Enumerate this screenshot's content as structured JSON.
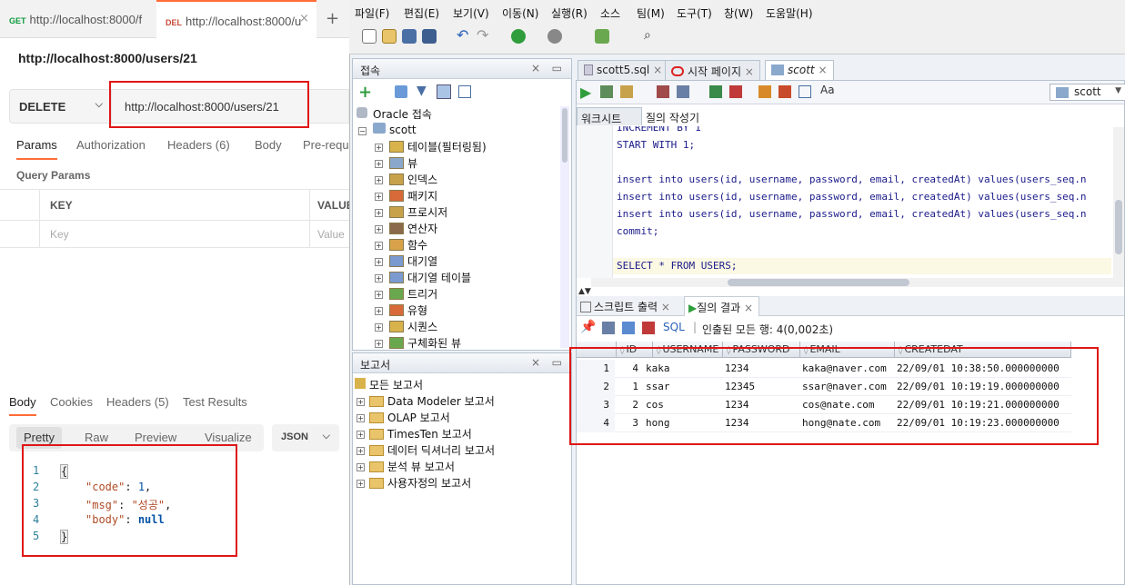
{
  "postman": {
    "tabs": [
      {
        "method": "GET",
        "label": "http://localhost:8000/f"
      },
      {
        "method": "DEL",
        "label": "http://localhost:8000/u"
      }
    ],
    "title": "http://localhost:8000/users/21",
    "method": "DELETE",
    "url": "http://localhost:8000/users/21",
    "request_tabs": {
      "params": "Params",
      "authorization": "Authorization",
      "headers": "Headers",
      "headers_count": "(6)",
      "body": "Body",
      "prerequest": "Pre-requ"
    },
    "query_params": "Query Params",
    "kv": {
      "key_header": "KEY",
      "value_header": "VALUE",
      "key_placeholder": "Key",
      "value_placeholder": "Value"
    },
    "response_tabs": {
      "body": "Body",
      "cookies": "Cookies",
      "headers": "Headers",
      "headers_count": "(5)",
      "tests": "Test Results"
    },
    "view_modes": [
      "Pretty",
      "Raw",
      "Preview",
      "Visualize"
    ],
    "format": "JSON",
    "response_lines": [
      "1",
      "2",
      "3",
      "4",
      "5"
    ],
    "response": {
      "open": "{",
      "close": "}",
      "code_key": "\"code\"",
      "code_val": "1",
      "msg_key": "\"msg\"",
      "msg_val": "\"성공\"",
      "body_key": "\"body\"",
      "body_val": "null"
    }
  },
  "sqldev": {
    "menu": [
      "파일(F)",
      "편집(E)",
      "보기(V)",
      "이동(N)",
      "실행(R)",
      "소스",
      "팀(M)",
      "도구(T)",
      "창(W)",
      "도움말(H)"
    ],
    "connections_title": "접속",
    "tree_root": "Oracle 접속",
    "tree_conn": "scott",
    "tree_items": [
      "테이블(필터링됨)",
      "뷰",
      "인덱스",
      "패키지",
      "프로시저",
      "연산자",
      "함수",
      "대기열",
      "대기열 테이블",
      "트리거",
      "유형",
      "시퀀스",
      "구체화된 뷰"
    ],
    "reports_title": "보고서",
    "reports_root": "모든 보고서",
    "reports_items": [
      "Data Modeler 보고서",
      "OLAP 보고서",
      "TimesTen 보고서",
      "데이터 딕셔너리 보고서",
      "분석 뷰 보고서",
      "사용자정의 보고서"
    ],
    "editor_tabs": [
      "scott5.sql",
      "시작 페이지",
      "scott"
    ],
    "connection_select": "scott",
    "worksheet_tabs": [
      "워크시트",
      "질의 작성기"
    ],
    "sql_lines": [
      "INCREMENT BY 1",
      "START WITH 1;",
      "",
      "insert into users(id, username, password, email, createdAt) values(users_seq.n",
      "insert into users(id, username, password, email, createdAt) values(users_seq.n",
      "insert into users(id, username, password, email, createdAt) values(users_seq.n",
      "commit;",
      "",
      "SELECT * FROM USERS;"
    ],
    "output_tabs": [
      "스크립트 출력",
      "질의 결과"
    ],
    "sql_label": "SQL",
    "fetch_status": "인출된 모든 행: 4(0,002초)",
    "columns": [
      "ID",
      "USERNAME",
      "PASSWORD",
      "EMAIL",
      "CREATEDAT"
    ],
    "rows": [
      [
        "1",
        "4",
        "kaka",
        "1234",
        "kaka@naver.com",
        "22/09/01 10:38:50.000000000"
      ],
      [
        "2",
        "1",
        "ssar",
        "12345",
        "ssar@naver.com",
        "22/09/01 10:19:19.000000000"
      ],
      [
        "3",
        "2",
        "cos",
        "1234",
        "cos@nate.com",
        "22/09/01 10:19:21.000000000"
      ],
      [
        "4",
        "3",
        "hong",
        "1234",
        "hong@nate.com",
        "22/09/01 10:19:23.000000000"
      ]
    ]
  }
}
